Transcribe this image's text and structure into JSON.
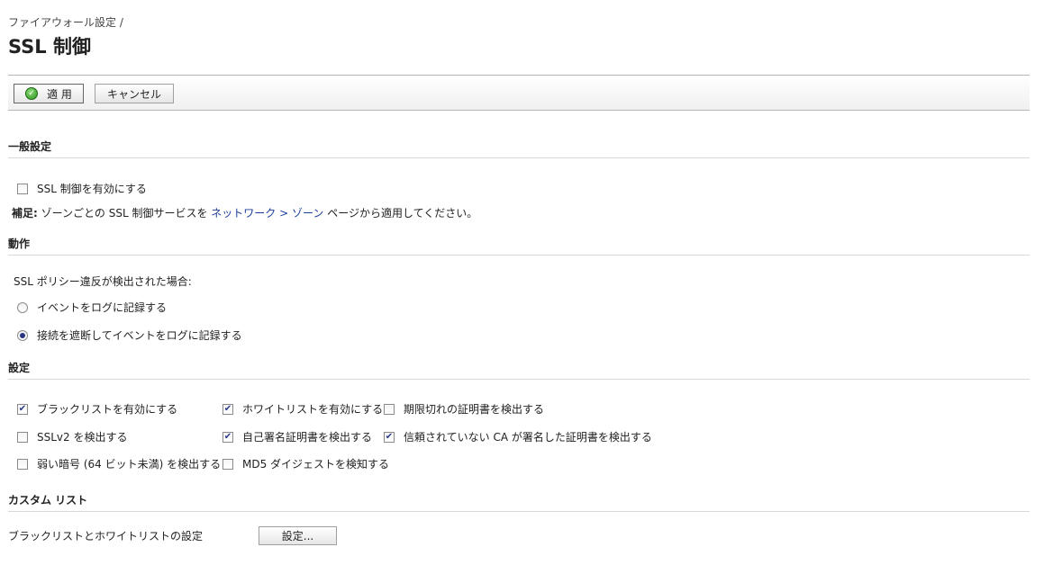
{
  "header": {
    "breadcrumb": "ファイアウォール設定 /",
    "title": "SSL 制御"
  },
  "toolbar": {
    "apply_label": "適 用",
    "cancel_label": "キャンセル"
  },
  "general": {
    "heading": "一般設定",
    "enable_label": "SSL 制御を有効にする",
    "enable_checked": false,
    "note_label": "補足:",
    "note_text_1": " ゾーンごとの SSL 制御サービスを ",
    "note_link": "ネットワーク > ゾーン",
    "note_text_2": " ページから適用してください。"
  },
  "action": {
    "heading": "動作",
    "prompt": "SSL ポリシー違反が検出された場合:",
    "options": [
      {
        "label": "イベントをログに記録する",
        "selected": false
      },
      {
        "label": "接続を遮断してイベントをログに記録する",
        "selected": true
      }
    ]
  },
  "config": {
    "heading": "設定",
    "options": [
      {
        "label": "ブラックリストを有効にする",
        "checked": true
      },
      {
        "label": "ホワイトリストを有効にする",
        "checked": true
      },
      {
        "label": "期限切れの証明書を検出する",
        "checked": false
      },
      {
        "label": "SSLv2 を検出する",
        "checked": false
      },
      {
        "label": "自己署名証明書を検出する",
        "checked": true
      },
      {
        "label": "信頼されていない CA が署名した証明書を検出する",
        "checked": true
      },
      {
        "label": "弱い暗号 (64 ビット未満) を検出する",
        "checked": false
      },
      {
        "label": "MD5 ダイジェストを検知する",
        "checked": false
      }
    ]
  },
  "custom": {
    "heading": "カスタム リスト",
    "label": "ブラックリストとホワイトリストの設定",
    "button_label": "設定..."
  },
  "icons": {
    "apply": "check-circle-icon",
    "checkmark": "checkmark-icon"
  },
  "colors": {
    "link": "#1a3f9a",
    "apply_icon": "#2a8f1c",
    "radio_dot": "#2a3580"
  }
}
